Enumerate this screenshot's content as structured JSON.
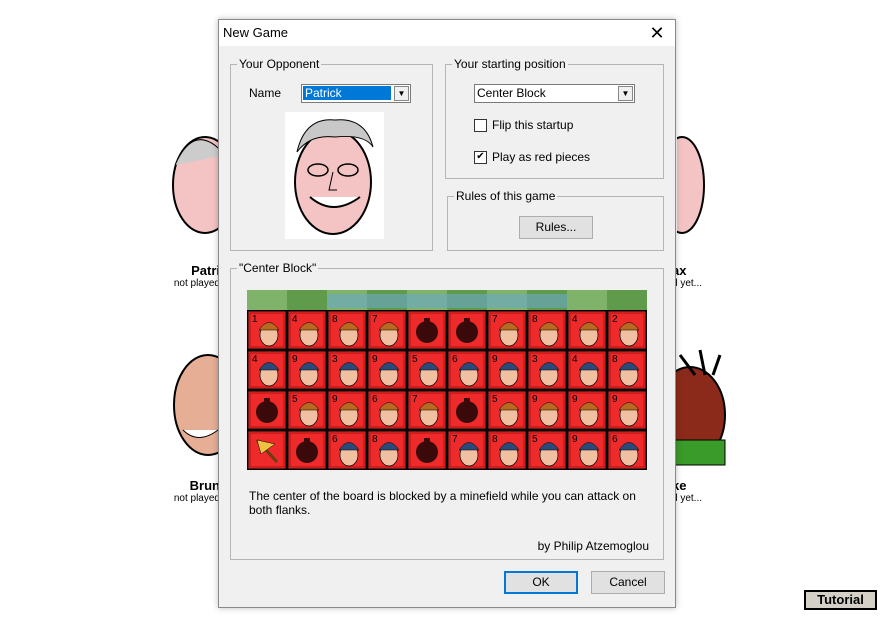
{
  "background": {
    "opponents": [
      {
        "name": "Patri",
        "status": "not played"
      },
      {
        "name": "ax",
        "status": "d yet..."
      },
      {
        "name": "Brun",
        "status": "not played"
      },
      {
        "name": "ke",
        "status": "d yet..."
      }
    ],
    "tutorial_label": "Tutorial"
  },
  "dialog": {
    "title": "New Game",
    "close_glyph": "✕",
    "opponent_group": {
      "label": "Your Opponent",
      "name_label": "Name",
      "selected_name": "Patrick"
    },
    "position_group": {
      "label": "Your starting position",
      "selected_position": "Center Block",
      "flip_label": "Flip this startup",
      "flip_checked": false,
      "red_label": "Play as red pieces",
      "red_checked": true
    },
    "rules_group": {
      "label": "Rules of this game",
      "button": "Rules..."
    },
    "setup_group": {
      "label": "\"Center Block\"",
      "description": "The center of the board is blocked by a minefield while you can attack on both flanks.",
      "author": "by Philip Atzemoglou"
    },
    "ok_label": "OK",
    "cancel_label": "Cancel"
  },
  "board": {
    "rows": [
      [
        "1",
        "4",
        "8",
        "7",
        "B",
        "B",
        "7",
        "8",
        "4",
        "2"
      ],
      [
        "4",
        "9",
        "3",
        "9",
        "5",
        "6",
        "9",
        "3",
        "4",
        "8"
      ],
      [
        "B",
        "5",
        "9",
        "6",
        "7",
        "B",
        "5",
        "9",
        "9",
        "9"
      ],
      [
        "F",
        "B",
        "6",
        "8",
        "B",
        "7",
        "8",
        "5",
        "9",
        "6"
      ]
    ]
  },
  "colors": {
    "piece_red": "#ee2a2a",
    "selection_blue": "#0078d7"
  }
}
